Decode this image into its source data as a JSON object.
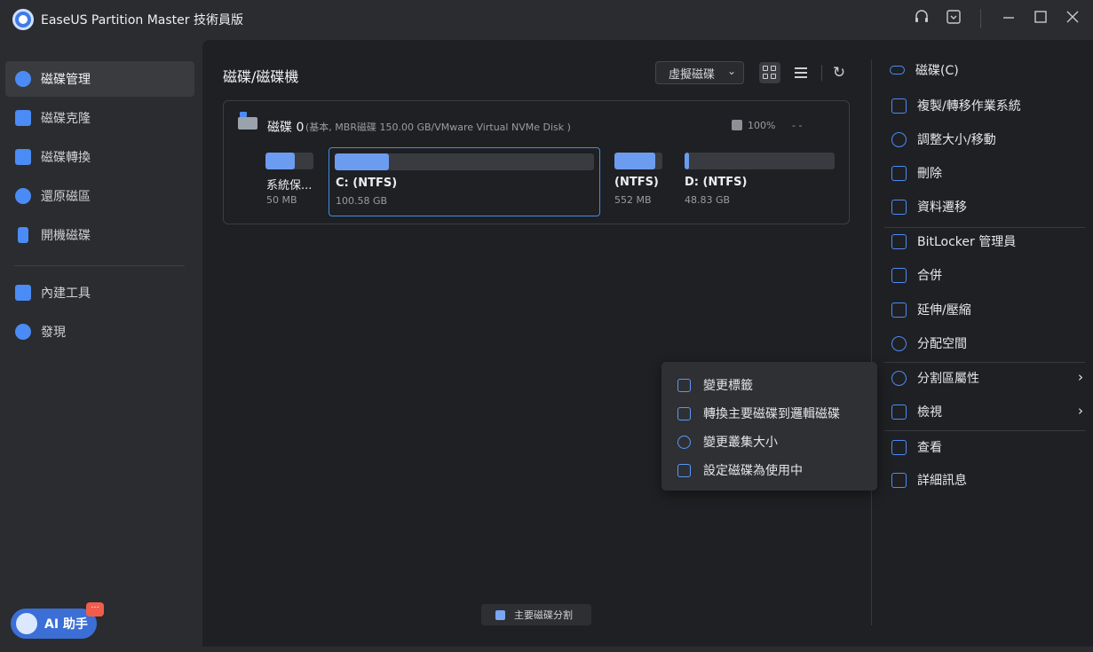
{
  "window": {
    "title": "EaseUS Partition Master 技術員版"
  },
  "sidebar": {
    "items": [
      {
        "label": "磁碟管理",
        "icon": "pie-chart-icon",
        "active": true
      },
      {
        "label": "磁碟克隆",
        "icon": "clone-icon",
        "active": false
      },
      {
        "label": "磁碟轉換",
        "icon": "convert-icon",
        "active": false
      },
      {
        "label": "還原磁區",
        "icon": "recover-icon",
        "active": false
      },
      {
        "label": "開機磁碟",
        "icon": "usb-drive-icon",
        "active": false
      },
      {
        "label": "內建工具",
        "icon": "toolbox-icon",
        "active": false
      },
      {
        "label": "發現",
        "icon": "compass-icon",
        "active": false
      }
    ],
    "ai_assistant": {
      "label": "AI 助手",
      "badge": "···"
    }
  },
  "main": {
    "title": "磁碟/磁碟機",
    "virtual_disk_label": "虛擬磁碟",
    "disk": {
      "name": "磁碟 0",
      "detail": "(基本, MBR磁碟 150.00 GB/VMware Virtual NVMe Disk )",
      "percent": "100%",
      "health": "- -",
      "partitions": [
        {
          "name": "系統保...",
          "size": "50 MB",
          "fill": 0.62,
          "selected": false
        },
        {
          "name": "C: (NTFS)",
          "size": "100.58 GB",
          "fill": 0.21,
          "selected": true
        },
        {
          "name": "(NTFS)",
          "size": "552 MB",
          "fill": 0.85,
          "selected": false
        },
        {
          "name": "D: (NTFS)",
          "size": "48.83 GB",
          "fill": 0.02,
          "selected": false
        }
      ]
    },
    "legend": {
      "label": "主要磁碟分割",
      "color": "#7aa6f2"
    }
  },
  "actions": {
    "header": "磁碟(C)",
    "items": [
      {
        "label": "複製/轉移作業系統",
        "icon": "migrate-os-icon"
      },
      {
        "label": "調整大小/移動",
        "icon": "resize-icon"
      },
      {
        "label": "刪除",
        "icon": "trash-icon"
      },
      {
        "label": "資料遷移",
        "icon": "data-migrate-icon"
      },
      {
        "label": "BitLocker 管理員",
        "icon": "bitlocker-icon"
      },
      {
        "label": "合併",
        "icon": "merge-icon"
      },
      {
        "label": "延伸/壓縮",
        "icon": "extend-icon"
      },
      {
        "label": "分配空間",
        "icon": "allocate-icon"
      },
      {
        "label": "分割區屬性",
        "icon": "properties-icon"
      },
      {
        "label": "檢視",
        "icon": "check-icon"
      },
      {
        "label": "查看",
        "icon": "explore-icon"
      },
      {
        "label": "詳細訊息",
        "icon": "details-icon"
      }
    ]
  },
  "context_menu": {
    "items": [
      {
        "label": "變更標籤",
        "icon": "tag-icon"
      },
      {
        "label": "轉換主要磁碟到邏輯磁碟",
        "icon": "convert-logical-icon"
      },
      {
        "label": "變更叢集大小",
        "icon": "cluster-icon"
      },
      {
        "label": "設定磁碟為使用中",
        "icon": "set-active-icon"
      }
    ]
  },
  "colors": {
    "accent": "#4b8bf5",
    "selected_border": "#3f8de9",
    "partition_fill": "#6c9cf0"
  }
}
